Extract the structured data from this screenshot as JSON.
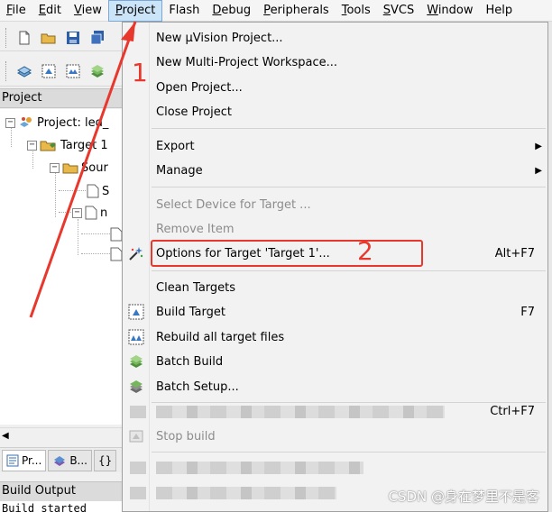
{
  "menubar": {
    "items": [
      {
        "label": "File",
        "u": "F",
        "rest": "ile"
      },
      {
        "label": "Edit",
        "u": "E",
        "rest": "dit"
      },
      {
        "label": "View",
        "u": "V",
        "rest": "iew"
      },
      {
        "label": "Project",
        "u": "P",
        "rest": "roject"
      },
      {
        "label": "Flash",
        "u": "",
        "rest": "Flash"
      },
      {
        "label": "Debug",
        "u": "D",
        "rest": "ebug"
      },
      {
        "label": "Peripherals",
        "u": "P",
        "rest": "eripherals"
      },
      {
        "label": "Tools",
        "u": "T",
        "rest": "ools"
      },
      {
        "label": "SVCS",
        "u": "S",
        "rest": "VCS"
      },
      {
        "label": "Window",
        "u": "W",
        "rest": "indow"
      },
      {
        "label": "Help",
        "u": "",
        "rest": "Help"
      }
    ]
  },
  "project_pane": {
    "title": "Project",
    "tree": {
      "project": "Project: led_",
      "target": "Target 1",
      "source": "Sour",
      "file1": "S",
      "file2": "n"
    },
    "tabs": {
      "tab1": "Pr...",
      "tab2": "B...",
      "tab3": "{}"
    }
  },
  "build_output": {
    "title": "Build Output",
    "line1": "Build started"
  },
  "project_menu": {
    "new_project": "New µVision Project...",
    "new_multi": "New Multi-Project Workspace...",
    "open_project": "Open Project...",
    "close_project": "Close Project",
    "export": "Export",
    "manage": "Manage",
    "select_device": "Select Device for Target ...",
    "remove_item": "Remove Item",
    "options": "Options for Target 'Target 1'...",
    "options_shortcut": "Alt+F7",
    "clean_targets": "Clean Targets",
    "build_target": "Build Target",
    "build_shortcut": "F7",
    "rebuild_all": "Rebuild all target files",
    "batch_build": "Batch Build",
    "batch_setup": "Batch Setup...",
    "hidden_shortcut": "Ctrl+F7",
    "stop_build": "Stop build"
  },
  "annotations": {
    "step1": "1",
    "step2": "2"
  },
  "watermark": "CSDN @身在梦里不是客",
  "colors": {
    "annotation_red": "#e8382d",
    "menu_highlight": "#cce4f7"
  }
}
